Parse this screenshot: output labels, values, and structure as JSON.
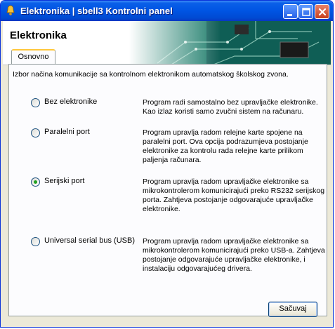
{
  "window": {
    "title": "Elektronika | sbell3 Kontrolni panel"
  },
  "header": {
    "title": "Elektronika"
  },
  "tabs": [
    {
      "label": "Osnovno",
      "active": true
    }
  ],
  "intro": "Izbor načina komunikacije sa kontrolnom elektronikom automatskog školskog zvona.",
  "options": [
    {
      "label": "Bez elektronike",
      "selected": false,
      "description": "Program radi samostalno bez upravljačke elektronike. Kao izlaz koristi samo zvučni sistem na računaru."
    },
    {
      "label": "Paralelni port",
      "selected": false,
      "description": "Program upravlja radom relejne karte spojene na paralelni port. Ova opcija podrazumjeva postojanje elektronike za kontrolu rada relejne karte prilikom paljenja računara."
    },
    {
      "label": "Serijski port",
      "selected": true,
      "description": "Program upravlja radom upravljačke elektronike sa mikrokontrolerom komunicirajući preko RS232 serijskog porta. Zahtjeva postojanje odgovarajuće upravljačke elektronike."
    },
    {
      "label": "Universal serial bus (USB)",
      "selected": false,
      "description": "Program upravlja radom upravljačke elektronike sa mikrokontrolerom komunicirajući preko USB-a. Zahtjeva postojanje odgovarajuće upravljačke elektronike, i instalaciju odgovarajućeg drivera."
    }
  ],
  "buttons": {
    "save": "Sačuvaj"
  },
  "colors": {
    "titlebar": "#0054e3",
    "window_bg": "#ece9d8",
    "selected_dot": "#21a121"
  },
  "icons": {
    "app": "bell-icon",
    "minimize": "minimize-icon",
    "maximize": "maximize-icon",
    "close": "close-icon",
    "header_art": "circuit-board-image"
  }
}
